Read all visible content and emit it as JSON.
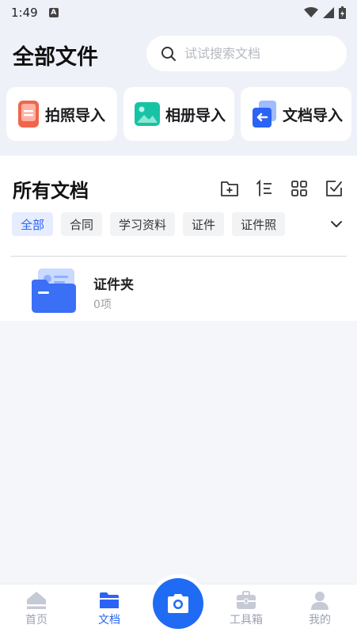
{
  "status_bar": {
    "time": "1:49",
    "notif_badge": "A"
  },
  "header": {
    "title": "全部文件",
    "search": {
      "placeholder": "试试搜索文档",
      "value": ""
    }
  },
  "import_actions": [
    {
      "label": "拍照导入",
      "icon": "phone-camera-icon",
      "color": "#f0654b"
    },
    {
      "label": "相册导入",
      "icon": "gallery-icon",
      "color": "#17c3a5"
    },
    {
      "label": "文档导入",
      "icon": "document-import-icon",
      "color": "#2a63f5"
    }
  ],
  "documents": {
    "title": "所有文档",
    "toolbar_icons": [
      "new-folder-icon",
      "sort-icon",
      "grid-view-icon",
      "select-icon"
    ],
    "filters": [
      "全部",
      "合同",
      "学习资料",
      "证件",
      "证件照"
    ],
    "active_filter": "全部",
    "folders": [
      {
        "name": "证件夹",
        "count": "0项"
      }
    ]
  },
  "tab_bar": {
    "tabs": [
      {
        "label": "首页",
        "icon": "home-icon",
        "active": false
      },
      {
        "label": "文档",
        "icon": "folder-icon",
        "active": true
      },
      {
        "label": "工具箱",
        "icon": "toolbox-icon",
        "active": false
      },
      {
        "label": "我的",
        "icon": "user-icon",
        "active": false
      }
    ],
    "center_action_icon": "camera-icon"
  },
  "colors": {
    "accent": "#2a63f5",
    "header_bg": "#eef1f8",
    "inactive_tab": "#9ba3b4"
  }
}
